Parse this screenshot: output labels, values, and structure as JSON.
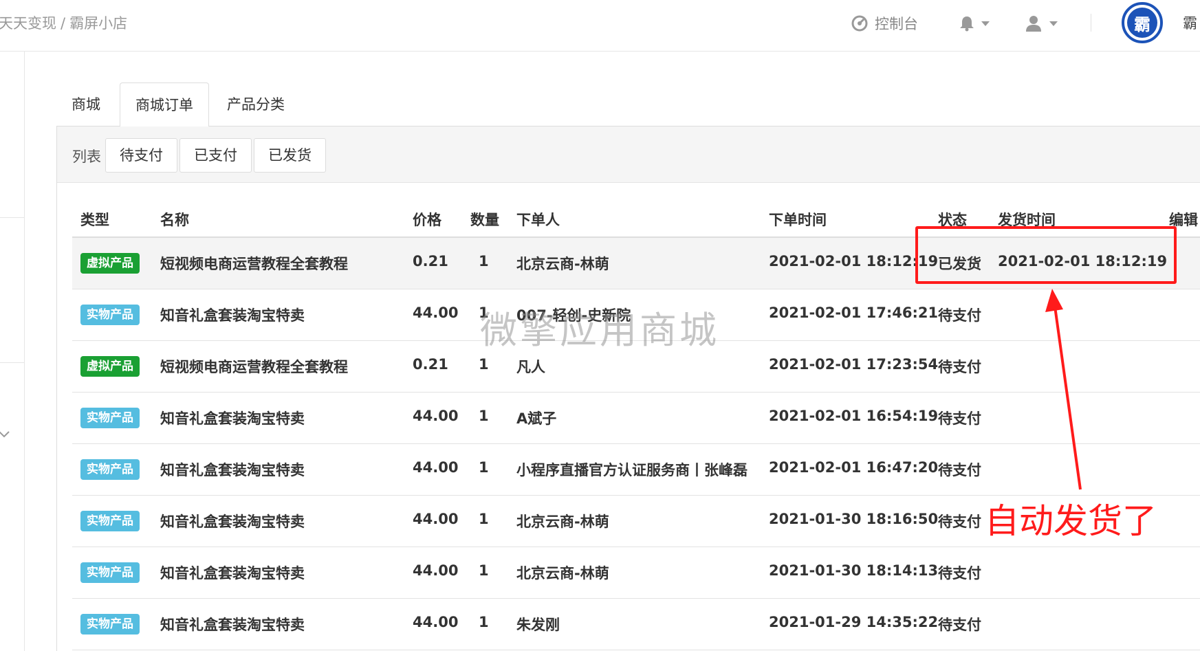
{
  "breadcrumb": {
    "part1": "天天变现",
    "sep": "/",
    "part2": "霸屏小店"
  },
  "header": {
    "console_label": "控制台",
    "logo_char": "霸",
    "user_name": "霸"
  },
  "tabs": [
    "商城",
    "商城订单",
    "产品分类"
  ],
  "filter": {
    "label": "列表",
    "buttons": [
      "待支付",
      "已支付",
      "已发货"
    ]
  },
  "table": {
    "headers": [
      "类型",
      "名称",
      "价格",
      "数量",
      "下单人",
      "下单时间",
      "状态",
      "发货时间",
      "编辑"
    ],
    "rows": [
      {
        "type": "虚拟产品",
        "name": "短视频电商运营教程全套教程",
        "price": "0.21",
        "qty": "1",
        "buyer": "北京云商-林萌",
        "time": "2021-02-01 18:12:19",
        "status": "已发货",
        "ship_time": "2021-02-01 18:12:19"
      },
      {
        "type": "实物产品",
        "name": "知音礼盒套装淘宝特卖",
        "price": "44.00",
        "qty": "1",
        "buyer": "007-轻创-史新院",
        "time": "2021-02-01 17:46:21",
        "status": "待支付",
        "ship_time": ""
      },
      {
        "type": "虚拟产品",
        "name": "短视频电商运营教程全套教程",
        "price": "0.21",
        "qty": "1",
        "buyer": "凡人",
        "time": "2021-02-01 17:23:54",
        "status": "待支付",
        "ship_time": ""
      },
      {
        "type": "实物产品",
        "name": "知音礼盒套装淘宝特卖",
        "price": "44.00",
        "qty": "1",
        "buyer": "A斌子",
        "time": "2021-02-01 16:54:19",
        "status": "待支付",
        "ship_time": ""
      },
      {
        "type": "实物产品",
        "name": "知音礼盒套装淘宝特卖",
        "price": "44.00",
        "qty": "1",
        "buyer": "小程序直播官方认证服务商丨张峰磊",
        "time": "2021-02-01 16:47:20",
        "status": "待支付",
        "ship_time": ""
      },
      {
        "type": "实物产品",
        "name": "知音礼盒套装淘宝特卖",
        "price": "44.00",
        "qty": "1",
        "buyer": "北京云商-林萌",
        "time": "2021-01-30 18:16:50",
        "status": "待支付",
        "ship_time": ""
      },
      {
        "type": "实物产品",
        "name": "知音礼盒套装淘宝特卖",
        "price": "44.00",
        "qty": "1",
        "buyer": "北京云商-林萌",
        "time": "2021-01-30 18:14:13",
        "status": "待支付",
        "ship_time": ""
      },
      {
        "type": "实物产品",
        "name": "知音礼盒套装淘宝特卖",
        "price": "44.00",
        "qty": "1",
        "buyer": "朱发刚",
        "time": "2021-01-29 14:35:22",
        "status": "待支付",
        "ship_time": ""
      }
    ]
  },
  "watermark": "微擎应用商城",
  "annotation": {
    "text": "自动发货了",
    "color": "#ff1b1b"
  },
  "colors": {
    "virtual_badge": "#1aa033",
    "physical_badge": "#55bde0",
    "logo_blue": "#1c53b8"
  }
}
